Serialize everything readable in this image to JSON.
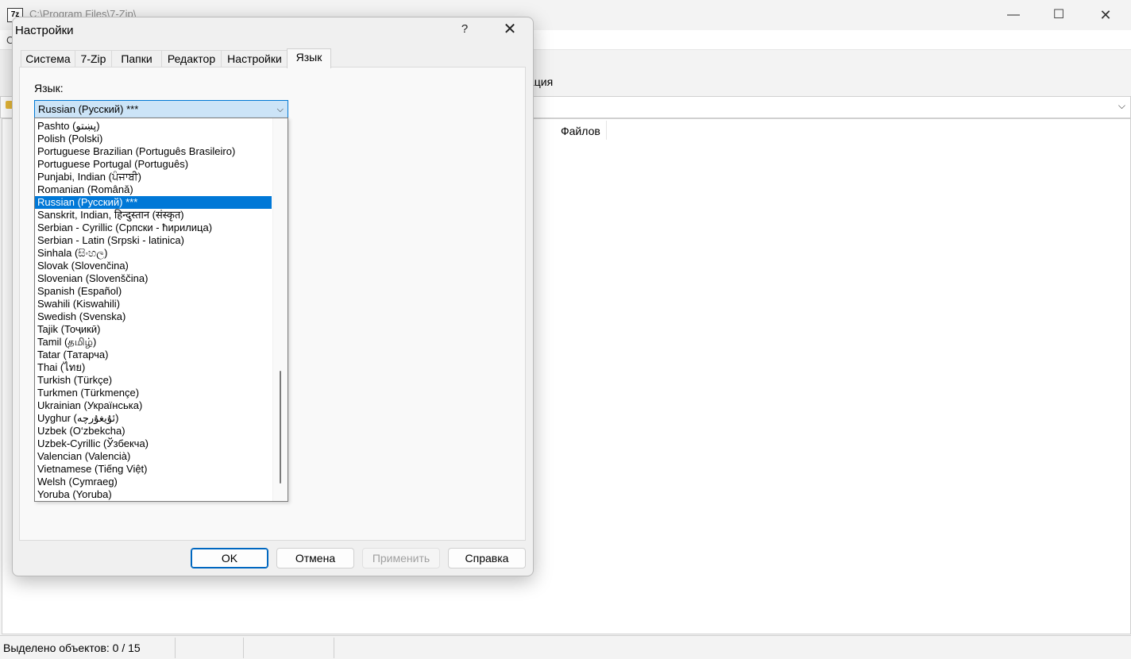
{
  "main_window": {
    "title": "C:\\Program Files\\7-Zip\\",
    "menu_first_letter": "С",
    "toolbar_info_label": "ация",
    "column_files": "Файлов",
    "status_selected": "Выделено объектов: 0 / 15"
  },
  "dialog": {
    "title": "Настройки",
    "help_symbol": "?",
    "close_symbol": "✕",
    "tabs": [
      {
        "label": "Система",
        "active": false
      },
      {
        "label": "7-Zip",
        "active": false
      },
      {
        "label": "Папки",
        "active": false
      },
      {
        "label": "Редактор",
        "active": false
      },
      {
        "label": "Настройки",
        "active": false
      },
      {
        "label": "Язык",
        "active": true
      }
    ],
    "language_label": "Язык:",
    "language_selected": "Russian (Русский)  ***",
    "language_options": [
      "Pashto (پښتو)",
      "Polish (Polski)",
      "Portuguese Brazilian (Português Brasileiro)",
      "Portuguese Portugal (Português)",
      "Punjabi, Indian (ਪੰਜਾਬੀ)",
      "Romanian (Română)",
      "Russian (Русский)  ***",
      "Sanskrit, Indian, हिन्दुस्तान (संस्कृत)",
      "Serbian - Cyrillic (Српски - ћирилица)",
      "Serbian - Latin (Srpski - latinica)",
      "Sinhala (සිංහල)",
      "Slovak (Slovenčina)",
      "Slovenian (Slovenščina)",
      "Spanish (Español)",
      "Swahili (Kiswahili)",
      "Swedish (Svenska)",
      "Tajik (Тоҷикӣ)",
      "Tamil (தமிழ்)",
      "Tatar (Татарча)",
      "Thai (ไทย)",
      "Turkish (Türkçe)",
      "Turkmen (Türkmençe)",
      "Ukrainian (Українська)",
      "Uyghur (ئۇيغۇرچە)",
      "Uzbek (O‘zbekcha)",
      "Uzbek-Cyrillic (Ўзбекча)",
      "Valencian (Valencià)",
      "Vietnamese (Tiếng Việt)",
      "Welsh (Cymraeg)",
      "Yoruba (Yoruba)"
    ],
    "selected_index": 6,
    "buttons": {
      "ok": "OK",
      "cancel": "Отмена",
      "apply": "Применить",
      "help": "Справка"
    }
  },
  "colors": {
    "selection": "#0078d7",
    "accent_border": "#0067c0",
    "combo_fill": "#cce4f7"
  }
}
